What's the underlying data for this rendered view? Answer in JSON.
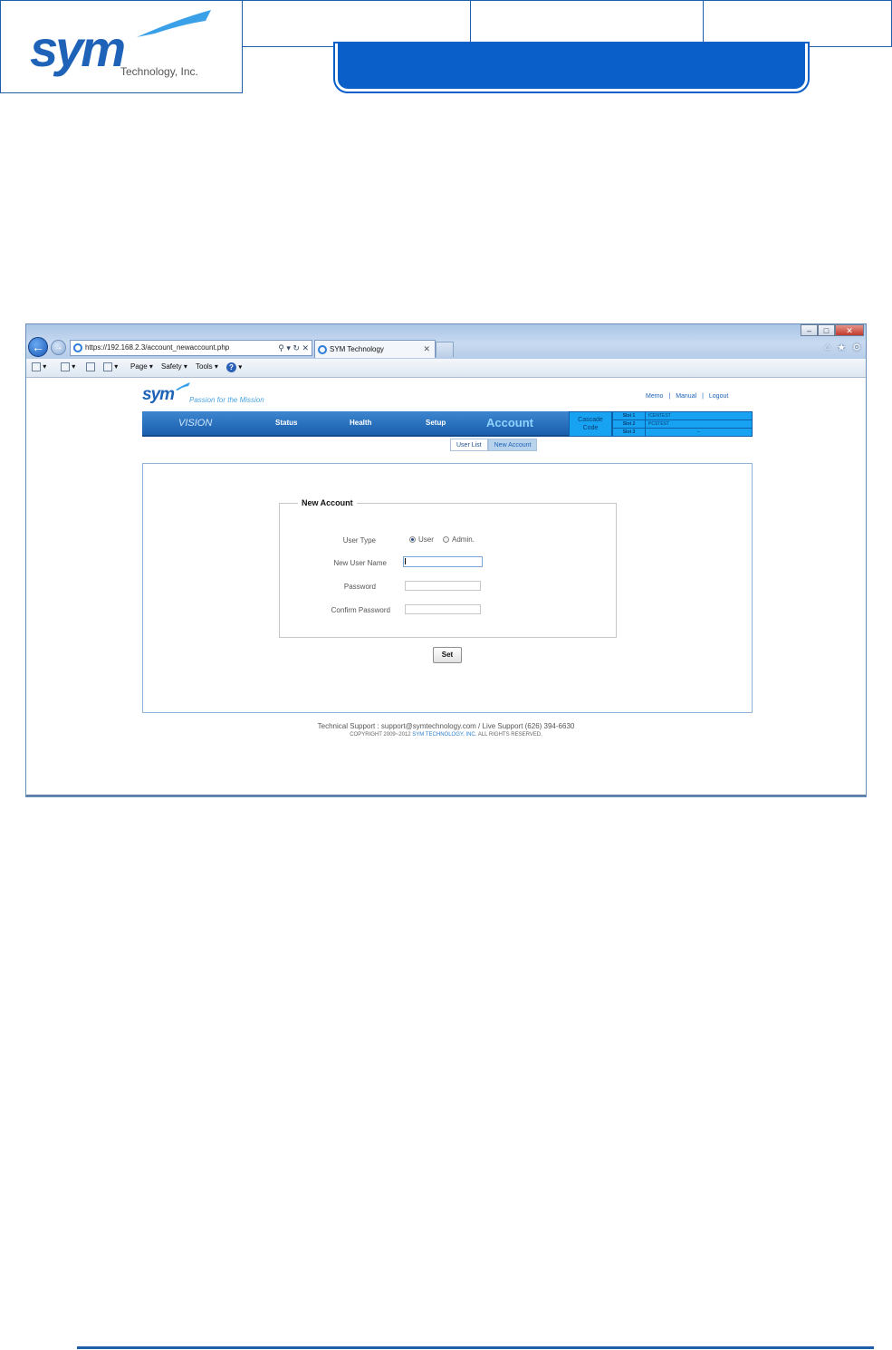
{
  "doc_header": {
    "logo_text": "sym",
    "logo_subtext": "Technology, Inc."
  },
  "browser": {
    "address_url": "https://192.168.2.3/account_newaccount.php",
    "address_tools": "⚲ ▾ ↻ ✕",
    "tab_title": "SYM Technology",
    "tab_close": "✕",
    "win_min": "–",
    "win_max": "□",
    "win_close": "✕",
    "right_icons": [
      "⌂",
      "★",
      "⚙"
    ],
    "command_bar": {
      "page": "Page ▾",
      "safety": "Safety ▾",
      "tools": "Tools ▾",
      "help": "?"
    }
  },
  "site": {
    "logo": "sym",
    "tagline": "Passion for the Mission",
    "top_links": [
      "Memo",
      "Manual",
      "Logout"
    ],
    "top_sep": "|",
    "nav": {
      "vision": "VISION",
      "status": "Status",
      "health": "Health",
      "setup": "Setup",
      "account": "Account"
    },
    "cascade": {
      "line1": "Cascade",
      "line2": "Code"
    },
    "slots": [
      {
        "label": "Slot 1",
        "value": "ICENTEST"
      },
      {
        "label": "Slot 2",
        "value": "PCSTEST"
      },
      {
        "label": "Slot 3",
        "value": "--"
      }
    ],
    "subnav": {
      "user_list": "User List",
      "new_account": "New Account"
    },
    "form": {
      "legend": "New Account",
      "user_type_label": "User Type",
      "option_user": "User",
      "option_admin": "Admin.",
      "selected_type": "User",
      "username_label": "New User Name",
      "password_label": "Password",
      "confirm_label": "Confirm Password",
      "set_button": "Set"
    },
    "footer": {
      "support": "Technical Support : support@symtechnology.com / Live Support (626) 394-6630",
      "copyright_prefix": "COPYRIGHT 2009~2012",
      "copyright_brand": "SYM TECHNOLOGY, INC.",
      "copyright_suffix": "ALL RIGHTS RESERVED."
    }
  },
  "colors": {
    "doc_blue": "#1f5ea8",
    "banner_blue": "#0a5fc8",
    "nav_blue": "#1a5fae",
    "cascade_cyan": "#18a3f2"
  }
}
